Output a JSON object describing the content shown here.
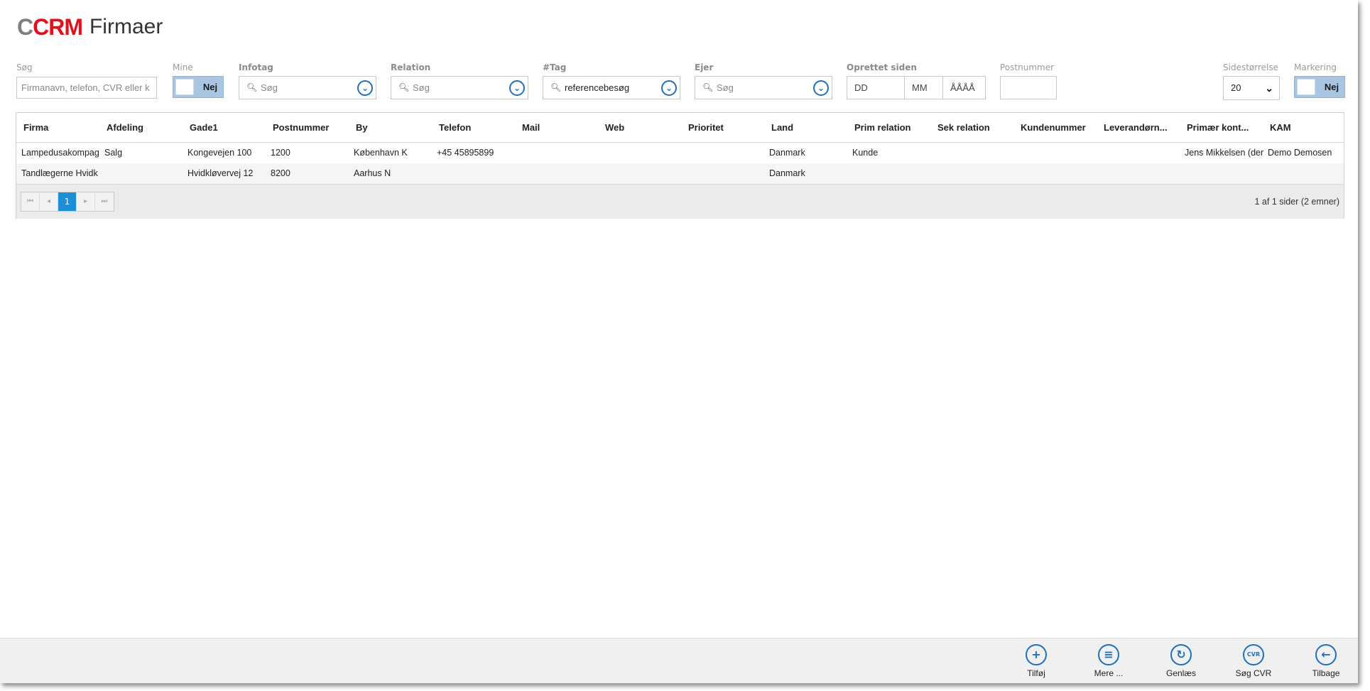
{
  "app": {
    "logo_c": "C",
    "logo_crm": "CRM",
    "title": "Firmaer"
  },
  "filters": {
    "search": {
      "label": "Søg",
      "placeholder": "Firmanavn, telefon, CVR eller k"
    },
    "mine": {
      "label": "Mine",
      "value": "Nej"
    },
    "infotag": {
      "label": "Infotag",
      "placeholder": "Søg"
    },
    "relation": {
      "label": "Relation",
      "placeholder": "Søg"
    },
    "tag": {
      "label": "#Tag",
      "value": "referencebesøg"
    },
    "ejer": {
      "label": "Ejer",
      "placeholder": "Søg"
    },
    "oprettet": {
      "label": "Oprettet siden",
      "dd": "DD",
      "mm": "MM",
      "yyyy": "ÅÅÅÅ"
    },
    "postnummer": {
      "label": "Postnummer",
      "value": ""
    },
    "sidestorrelse": {
      "label": "Sidestørrelse",
      "value": "20"
    },
    "markering": {
      "label": "Markering",
      "value": "Nej"
    }
  },
  "grid": {
    "columns": [
      "Firma",
      "Afdeling",
      "Gade1",
      "Postnummer",
      "By",
      "Telefon",
      "Mail",
      "Web",
      "Prioritet",
      "Land",
      "Prim relation",
      "Sek relation",
      "Kundenummer",
      "Leverandørn...",
      "Primær kont...",
      "KAM"
    ],
    "rows": [
      [
        "Lampedusakompag",
        "Salg",
        "Kongevejen 100",
        "1200",
        "København K",
        "+45 45895899",
        "",
        "",
        "",
        "Danmark",
        "Kunde",
        "",
        "",
        "",
        "Jens Mikkelsen (der",
        "Demo Demosen"
      ],
      [
        "Tandlægerne Hvidk",
        "",
        "Hvidkløvervej 12",
        "8200",
        "Aarhus N",
        "",
        "",
        "",
        "",
        "Danmark",
        "",
        "",
        "",
        "",
        "",
        ""
      ]
    ]
  },
  "pager": {
    "current": "1",
    "info": "1 af 1 sider (2 emner)"
  },
  "actions": [
    {
      "label": "Tilføj",
      "icon": "plus-icon",
      "glyph": "+"
    },
    {
      "label": "Mere ...",
      "icon": "menu-icon",
      "glyph": "≡"
    },
    {
      "label": "Genlæs",
      "icon": "refresh-icon",
      "glyph": "↻"
    },
    {
      "label": "Søg CVR",
      "icon": "cvr-icon",
      "glyph": "CVR"
    },
    {
      "label": "Tilbage",
      "icon": "back-arrow-icon",
      "glyph": "←"
    }
  ],
  "colors": {
    "brand_red": "#e3111b",
    "brand_gray": "#7f7f7f",
    "accent_blue": "#1e6fc0",
    "pager_active": "#1e8fd5",
    "toggle_bg": "#a8c6e2"
  }
}
